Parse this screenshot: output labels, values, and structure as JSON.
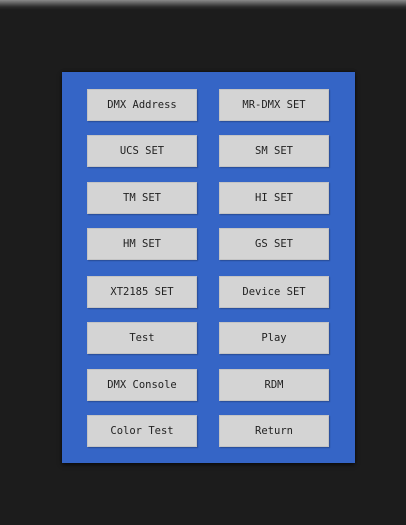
{
  "menu": {
    "buttons": [
      {
        "label": "DMX Address"
      },
      {
        "label": "MR-DMX SET"
      },
      {
        "label": "UCS SET"
      },
      {
        "label": "SM SET"
      },
      {
        "label": "TM SET"
      },
      {
        "label": "HI SET"
      },
      {
        "label": "HM SET"
      },
      {
        "label": "GS SET"
      },
      {
        "label": "XT2185 SET"
      },
      {
        "label": "Device SET"
      },
      {
        "label": "Test"
      },
      {
        "label": "Play"
      },
      {
        "label": "DMX Console"
      },
      {
        "label": "RDM"
      },
      {
        "label": "Color Test"
      },
      {
        "label": "Return"
      }
    ]
  },
  "colors": {
    "panel": "#3565c6",
    "button": "#d4d4d4",
    "background": "#1c1c1c"
  }
}
